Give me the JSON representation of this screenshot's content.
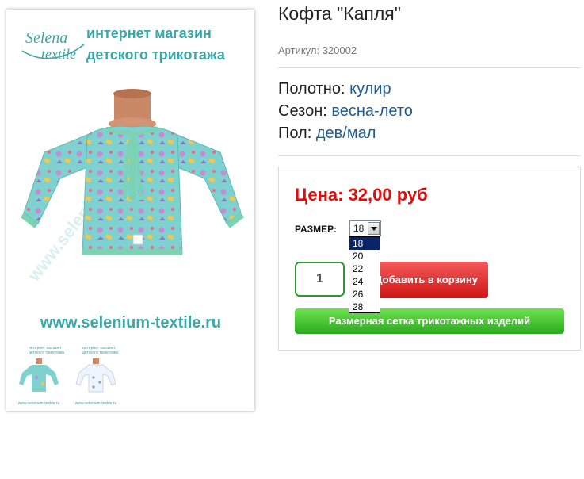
{
  "product": {
    "title": "Кофта \"Капля\"",
    "article": "Артикул: 320002"
  },
  "properties": [
    {
      "label": "Полотно:",
      "value": "кулир"
    },
    {
      "label": "Сезон:",
      "value": "весна-лето"
    },
    {
      "label": "Пол:",
      "value": "дев/мал"
    }
  ],
  "image": {
    "brand_script_line1": "Selena",
    "brand_script_line2": "textile",
    "headline_line1": "интернет магазин",
    "headline_line2": "детского трикотажа",
    "url": "www.selenium-textile.ru",
    "watermark": "www.selenium-textile.ru",
    "thumb_url": "www.selenium-textile.ru"
  },
  "buy": {
    "price": "Цена: 32,00 руб",
    "size_label": "РАЗМЕР:",
    "size_selected": "18",
    "size_options": [
      "18",
      "20",
      "22",
      "24",
      "26",
      "28"
    ],
    "quantity": "1",
    "cart_button": "Добавить в корзину",
    "size_grid_button": "Размерная сетка трикотажных изделий"
  },
  "colors": {
    "price": "#e00d0d",
    "property_value": "#1f5d94",
    "brand_teal": "#3aa7a8",
    "cart_button": "#e02222",
    "grid_button": "#44c534"
  }
}
